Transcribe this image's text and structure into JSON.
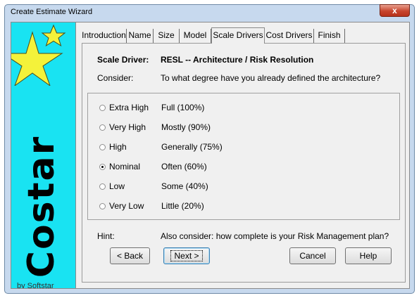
{
  "window": {
    "title": "Create Estimate Wizard",
    "close_label": "x"
  },
  "banner": {
    "brand": "Costar",
    "vendor": "by Softstar"
  },
  "tabs": [
    {
      "label": "Introduction"
    },
    {
      "label": "Name"
    },
    {
      "label": "Size"
    },
    {
      "label": "Model"
    },
    {
      "label": "Scale Drivers"
    },
    {
      "label": "Cost Drivers"
    },
    {
      "label": "Finish"
    }
  ],
  "active_tab": "Scale Drivers",
  "page": {
    "driver_label": "Scale Driver:",
    "driver_value": "RESL -- Architecture / Risk Resolution",
    "consider_label": "Consider:",
    "consider_text": "To what degree have you already defined the architecture?",
    "hint_label": "Hint:",
    "hint_text": "Also consider: how complete is your Risk Management plan?"
  },
  "options": [
    {
      "rating": "Extra High",
      "description": "Full (100%)",
      "selected": false
    },
    {
      "rating": "Very High",
      "description": "Mostly (90%)",
      "selected": false
    },
    {
      "rating": "High",
      "description": "Generally (75%)",
      "selected": false
    },
    {
      "rating": "Nominal",
      "description": "Often (60%)",
      "selected": true
    },
    {
      "rating": "Low",
      "description": "Some (40%)",
      "selected": false
    },
    {
      "rating": "Very Low",
      "description": "Little (20%)",
      "selected": false
    }
  ],
  "buttons": {
    "back": "< Back",
    "next": "Next >",
    "cancel": "Cancel",
    "help": "Help"
  },
  "colors": {
    "banner": "#19e3f2",
    "star": "#f4f23a",
    "titlebar": "#c7d9ee",
    "close": "#c7452d"
  },
  "icons": {
    "banner_stars": "star-icon",
    "close": "close-icon"
  }
}
